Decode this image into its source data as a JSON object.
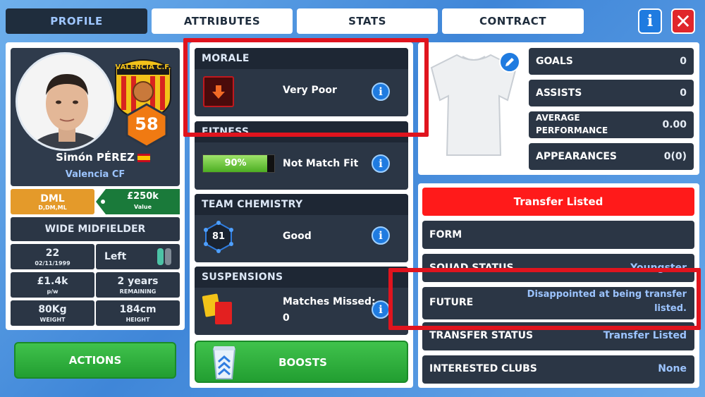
{
  "tabs": {
    "profile": "PROFILE",
    "attributes": "ATTRIBUTES",
    "stats": "STATS",
    "contract": "CONTRACT"
  },
  "topbar": {
    "info_glyph": "i",
    "close_glyph": "✕"
  },
  "player": {
    "name": "Simón PÉREZ",
    "club": "Valencia CF",
    "rating": "58",
    "club_badge_text": "VALENCIA C.F.",
    "position_code": "DML",
    "positions": "D,DM,ML",
    "value": "£250k",
    "value_label": "Value",
    "role": "WIDE MIDFIELDER",
    "age": "22",
    "dob": "02/11/1999",
    "foot": "Left",
    "wage": "£1.4k",
    "wage_label": "p/w",
    "contract_years": "2 years",
    "contract_label": "REMAINING",
    "weight": "80Kg",
    "weight_label": "WEIGHT",
    "height": "184cm",
    "height_label": "HEIGHT"
  },
  "buttons": {
    "actions": "ACTIONS",
    "boosts": "BOOSTS"
  },
  "morale": {
    "title": "MORALE",
    "value": "Very Poor"
  },
  "fitness": {
    "title": "FITNESS",
    "percent_text": "90%",
    "percent": 0.9,
    "status": "Not Match Fit"
  },
  "chemistry": {
    "title": "TEAM CHEMISTRY",
    "value_num": "81",
    "status": "Good"
  },
  "suspensions": {
    "title": "SUSPENSIONS",
    "label": "Matches Missed:",
    "value": "0"
  },
  "stats": {
    "goals_label": "GOALS",
    "goals": "0",
    "assists_label": "ASSISTS",
    "assists": "0",
    "avg_label_1": "AVERAGE",
    "avg_label_2": "PERFORMANCE",
    "avg": "0.00",
    "apps_label": "APPEARANCES",
    "apps": "0(0)"
  },
  "status": {
    "banner": "Transfer Listed",
    "form_label": "FORM",
    "squad_label": "SQUAD STATUS",
    "squad_value": "Youngster",
    "future_label": "FUTURE",
    "future_value_1": "Disappointed at being transfer",
    "future_value_2": "listed.",
    "transfer_label": "TRANSFER STATUS",
    "transfer_value": "Transfer Listed",
    "clubs_label": "INTERESTED CLUBS",
    "clubs_value": "None"
  },
  "colors": {
    "accent_blue": "#1f7be0",
    "red_highlight": "#e0141e",
    "orange_rating": "#f07a12",
    "green_button": "#2eb13c",
    "banner_red": "#ff1a1a"
  }
}
